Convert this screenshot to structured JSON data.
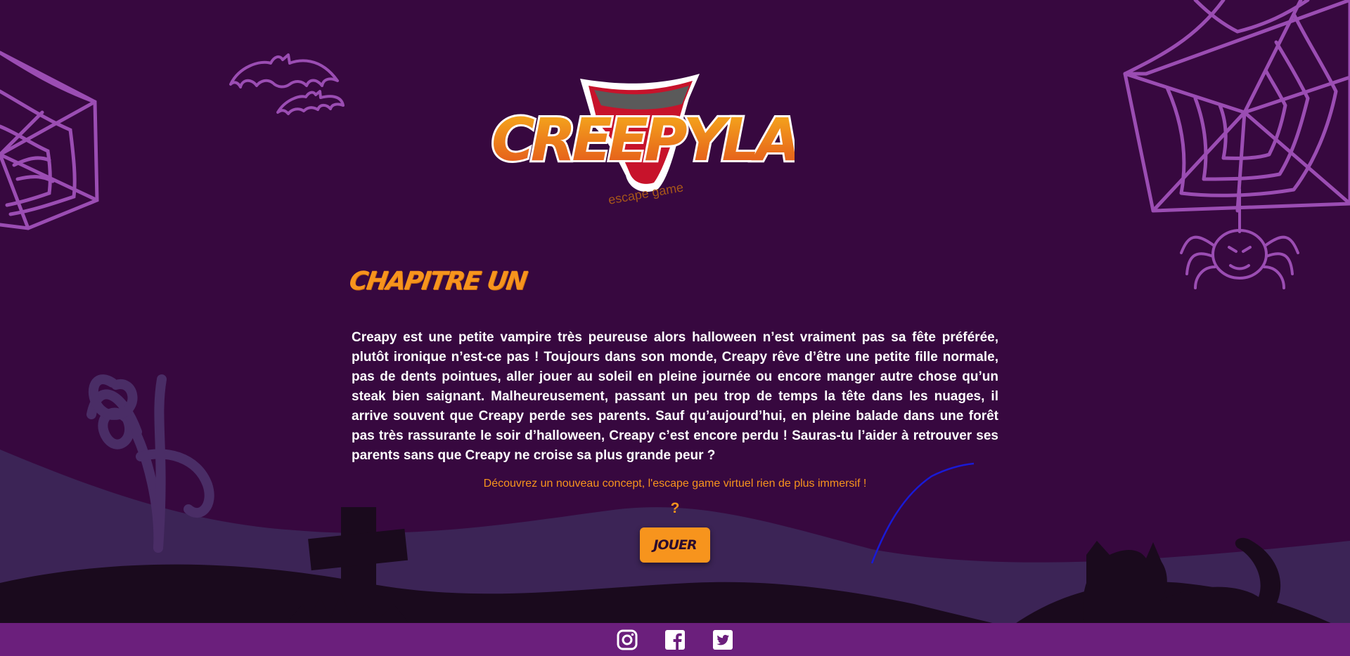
{
  "logo": {
    "wordmark": "CREEPYLAND",
    "subtitle": "escape game"
  },
  "chapter": {
    "title": "CHAPITRE UN"
  },
  "story": {
    "text": "Creapy est une petite vampire très peureuse alors halloween n’est vraiment pas sa fête préférée, plutôt ironique n’est-ce pas ! Toujours dans son monde, Creapy rêve d’être une petite fille normale, pas de dents pointues, aller jouer au soleil en pleine journée ou encore manger autre chose qu’un steak bien saignant. Malheureusement, passant un peu trop de temps la tête dans les nuages, il arrive souvent que Creapy perde ses parents. Sauf qu’aujourd’hui, en pleine balade dans une forêt pas très rassurante le soir d’halloween, Creapy c’est encore perdu ! Sauras-tu l’aider à retrouver ses parents sans que Creapy ne croise sa plus grande peur ?"
  },
  "cta": {
    "tagline": "Découvrez un nouveau concept, l'escape game virtuel rien de plus immersif !",
    "question": "?",
    "play_label": "JOUER"
  },
  "footer": {
    "icons": [
      "instagram-icon",
      "facebook-icon",
      "twitter-icon"
    ]
  },
  "colors": {
    "background": "#37083f",
    "accent_orange": "#f7941d",
    "decor_purple": "#9b4db3",
    "hill_mid": "#3c2456",
    "hill_dark": "#1a0a1d",
    "footer": "#6b1f7c"
  }
}
